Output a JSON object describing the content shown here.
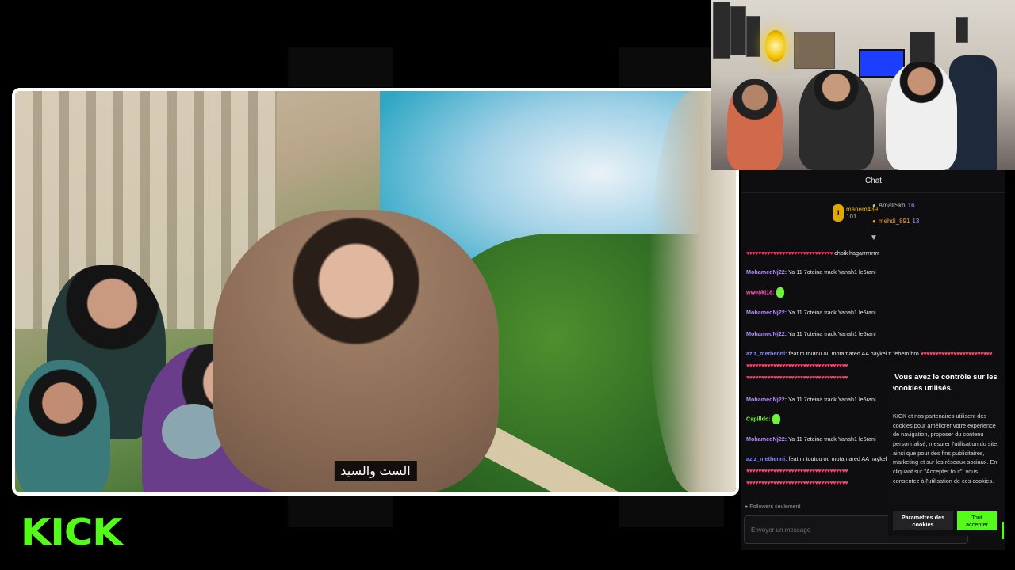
{
  "video": {
    "subtitle": "الست والسيد"
  },
  "chat": {
    "header_title": "Chat",
    "top_gifters": [
      {
        "rank": "1",
        "name": "mariem439",
        "count": "101"
      },
      {
        "name": "AmaliSkh",
        "count": "16"
      },
      {
        "name": "mehdi_891",
        "count": "13"
      }
    ],
    "messages": [
      {
        "user": "",
        "hearts": "♥♥♥♥♥♥♥♥♥♥♥♥♥♥♥♥♥♥♥♥♥♥♥♥♥♥♥♥♥",
        "text": "chbik hagarrrrrrrrr"
      },
      {
        "user": "MohamedNj22:",
        "text": "Ya 11 7oteina track Yanah1 le5rani"
      },
      {
        "user": "wwe8kj18:",
        "emote": true
      },
      {
        "user": "MohamedNj22:",
        "text": "Ya 11 7oteina track Yanah1 le5rani"
      },
      {
        "user": "MohamedNj22:",
        "text": "Ya 11 7oteina track Yanah1 le5rani"
      },
      {
        "user": "aziz_methenni:",
        "text": "feat m toutou ou motamared AA haykel tt fehem bro",
        "hearts": "♥♥♥♥♥♥♥♥♥♥♥♥♥♥♥♥♥♥♥♥♥♥♥♥"
      },
      {
        "user": "",
        "hearts": "♥♥♥♥♥♥♥♥♥♥♥♥♥♥♥♥♥♥♥♥♥♥♥♥♥♥♥♥♥♥♥♥♥♥"
      },
      {
        "user": "",
        "hearts": "♥♥♥♥♥♥♥♥♥♥♥♥♥♥♥♥♥♥♥♥♥♥♥♥♥♥♥♥♥♥♥♥♥♥"
      },
      {
        "user": "MohamedNj22:",
        "text": "Ya 11 7oteina track Yanah1 le5rani"
      },
      {
        "user": "Capilldo:",
        "emote": true
      },
      {
        "user": "MohamedNj22:",
        "text": "Ya 11 7oteina track Yanah1 le5rani"
      },
      {
        "user": "aziz_methenni:",
        "text": "feat m toutou ou motamared AA haykel tt fehem bro",
        "hearts": "♥♥♥♥♥♥♥♥♥♥♥♥♥♥♥♥♥♥♥♥♥♥♥♥"
      },
      {
        "user": "",
        "hearts": "♥♥♥♥♥♥♥♥♥♥♥♥♥♥♥♥♥♥♥♥♥♥♥♥♥♥♥♥♥♥♥♥♥♥"
      },
      {
        "user": "",
        "hearts": "♥♥♥♥♥♥♥♥♥♥♥♥♥♥♥♥♥♥♥♥♥♥♥♥♥♥♥♥♥♥♥♥♥♥"
      }
    ],
    "followers_only": "Followers seulement",
    "input_placeholder": "Envoyer un message"
  },
  "cookie": {
    "title": "Vous avez le contrôle sur les cookies utilisés.",
    "body": "KICK et nos partenaires utilisent des cookies pour améliorer votre expérience de navigation, proposer du contenu personnalisé, mesurer l'utilisation du site, ainsi que pour des fins publicitaires, marketing et sur les réseaux sociaux. En cliquant sur \"Accepter tout\", vous consentez à l'utilisation de ces cookies.",
    "settings_label": "Paramètres des cookies",
    "accept_label": "Tout accepter"
  },
  "brand": {
    "logo_text": "KICK",
    "accent_color": "#53fc18"
  },
  "icons": [
    "pin-icon",
    "cookie-icon",
    "crown-icon",
    "gift-icon"
  ]
}
